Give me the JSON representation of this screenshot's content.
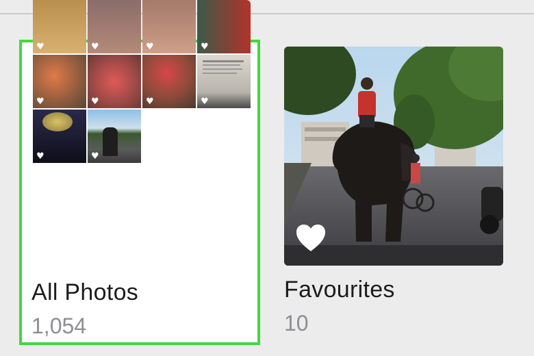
{
  "albums": [
    {
      "title": "All Photos",
      "count": "1,054",
      "selected": true,
      "thumbnails": [
        {
          "desc-icon": "photo-thumb",
          "favorite": true
        },
        {
          "desc-icon": "photo-thumb",
          "favorite": true
        },
        {
          "desc-icon": "photo-thumb",
          "favorite": true
        },
        {
          "desc-icon": "photo-thumb",
          "favorite": true
        },
        {
          "desc-icon": "photo-thumb",
          "favorite": true
        },
        {
          "desc-icon": "photo-thumb",
          "favorite": true
        },
        {
          "desc-icon": "photo-thumb",
          "favorite": true
        },
        {
          "desc-icon": "photo-thumb",
          "favorite": true
        },
        {
          "desc-icon": "photo-thumb",
          "favorite": true
        },
        {
          "desc-icon": "photo-thumb",
          "favorite": true
        }
      ]
    },
    {
      "title": "Favourites",
      "count": "10",
      "selected": false
    }
  ],
  "colors": {
    "selection_outline": "#3fd93f",
    "background": "#ececec",
    "count_text": "#8e8e93"
  },
  "icons": {
    "favorite": "heart-icon"
  }
}
